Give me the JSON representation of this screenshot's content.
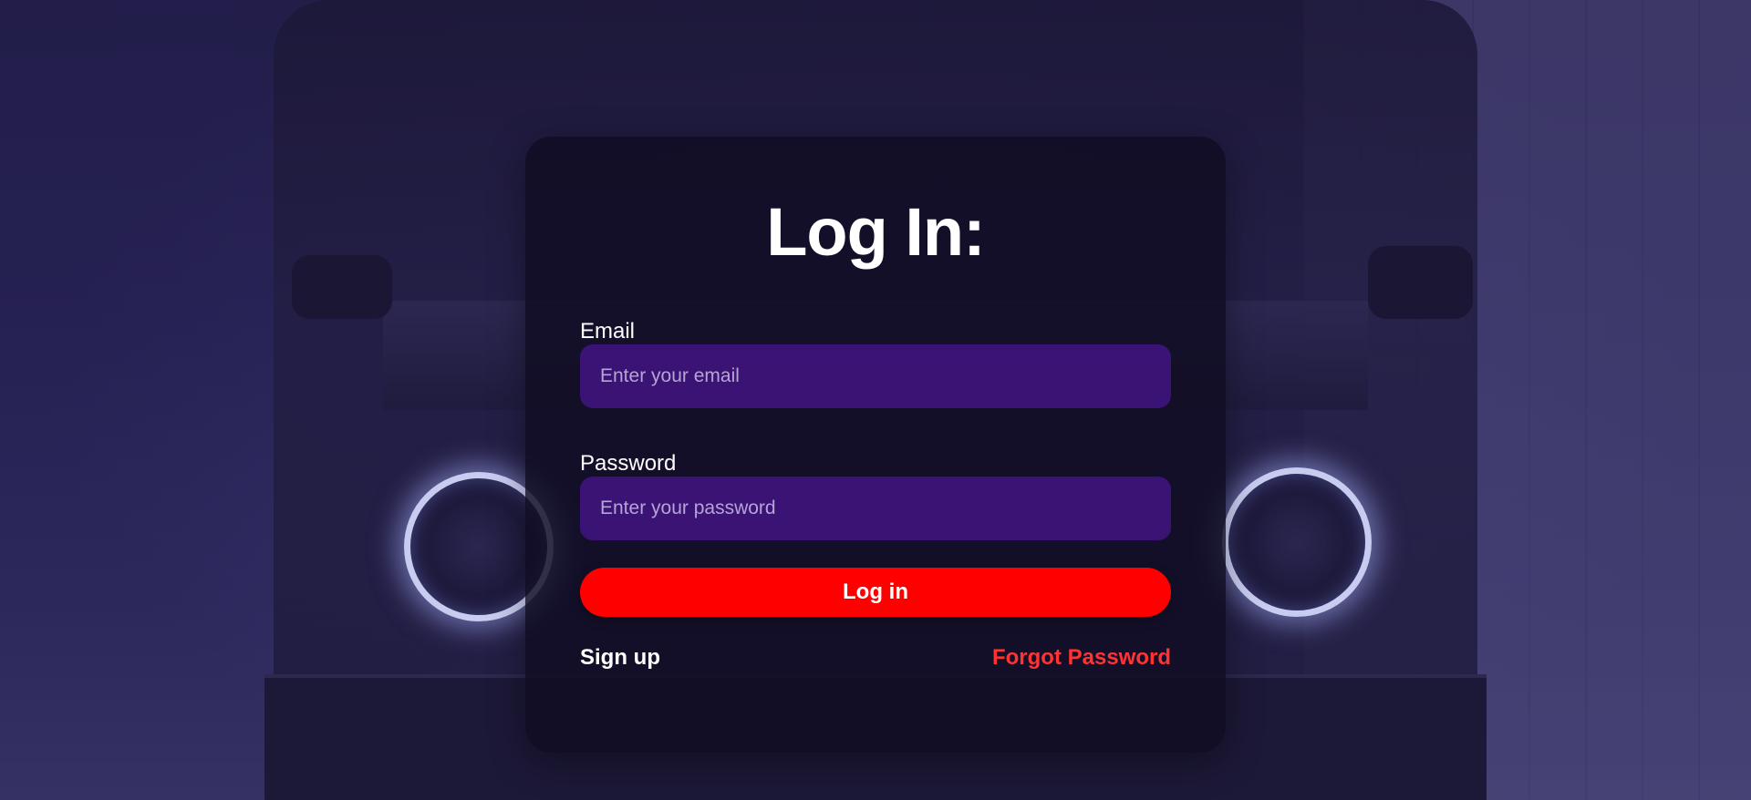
{
  "form": {
    "title": "Log In:",
    "email_label": "Email",
    "email_placeholder": "Enter your email",
    "password_label": "Password",
    "password_placeholder": "Enter your password",
    "login_label": "Log in",
    "signup_label": "Sign up",
    "forgot_label": "Forgot Password"
  },
  "colors": {
    "accent_red": "#ff0000",
    "forgot_link": "#ff3333",
    "input_fill": "#46148c",
    "card_bg": "#100c22"
  }
}
